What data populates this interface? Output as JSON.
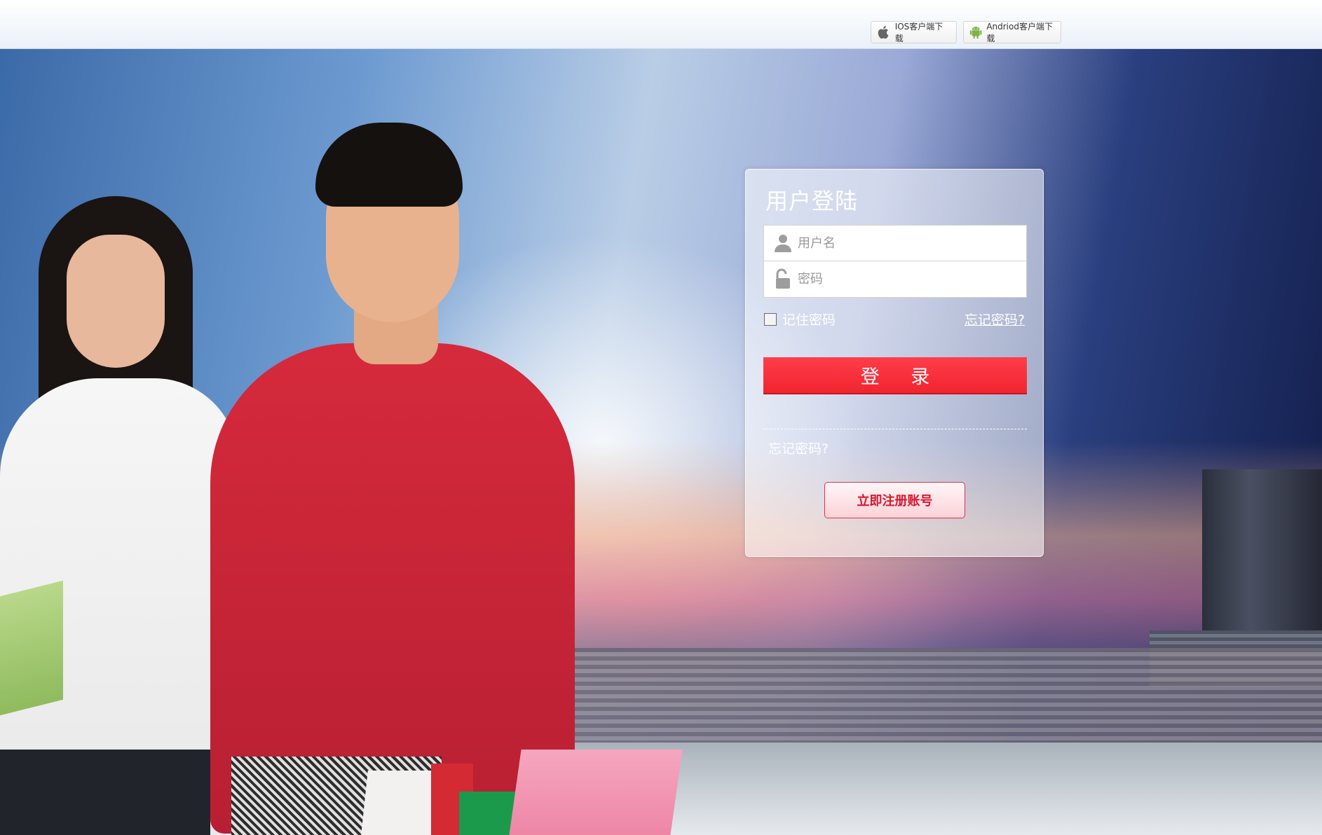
{
  "header": {
    "ios_download_label": "IOS客户端下载",
    "android_download_label": "Andriod客户端下载"
  },
  "login": {
    "title": "用户登陆",
    "username_placeholder": "用户名",
    "password_placeholder": "密码",
    "remember_label": "记住密码",
    "forgot_top_label": "忘记密码?",
    "submit_label": "登 录",
    "forgot_bottom_label": "忘记密码?",
    "register_label": "立即注册账号"
  },
  "colors": {
    "login_button": "#f0252f",
    "register_text": "#d6172e",
    "android_green": "#7cb342"
  }
}
